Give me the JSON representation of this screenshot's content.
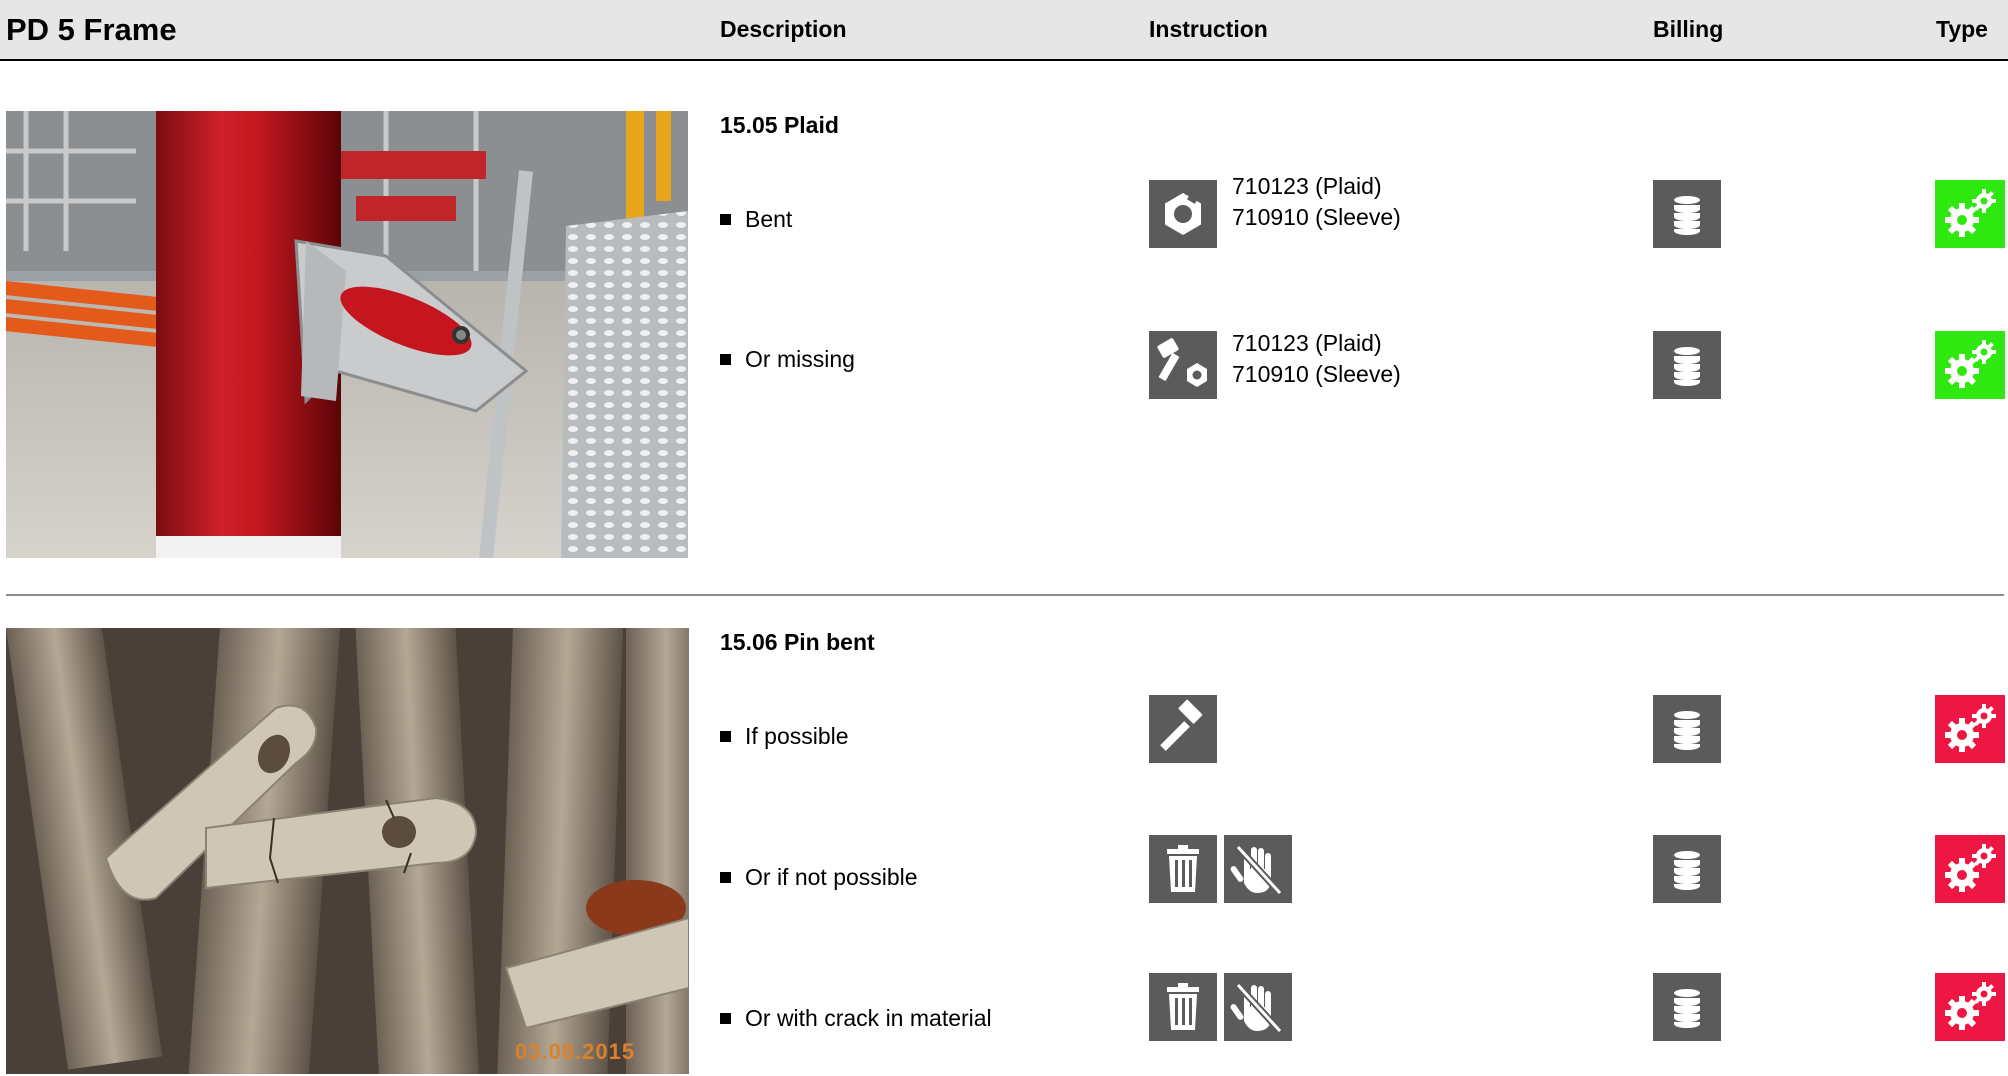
{
  "header": {
    "title": "PD 5 Frame",
    "col_description": "Description",
    "col_instruction": "Instruction",
    "col_billing": "Billing",
    "col_type": "Type"
  },
  "sections": [
    {
      "title": "15.05 Plaid",
      "items": [
        {
          "label": "Bent",
          "instruction_icons": [
            "nut-icon"
          ],
          "refs": [
            "710123 (Plaid)",
            "710910 (Sleeve)"
          ],
          "billing_icon": "coin-stack-icon",
          "type_icon": "gears-icon",
          "type_color": "#2ee80f"
        },
        {
          "label": "Or missing",
          "instruction_icons": [
            "bolt-nut-icon"
          ],
          "refs": [
            "710123 (Plaid)",
            "710910 (Sleeve)"
          ],
          "billing_icon": "coin-stack-icon",
          "type_icon": "gears-icon",
          "type_color": "#2ee80f"
        }
      ]
    },
    {
      "title": "15.06 Pin bent",
      "items": [
        {
          "label": "If possible",
          "instruction_icons": [
            "hammer-icon"
          ],
          "refs": [],
          "billing_icon": "coin-stack-icon",
          "type_icon": "gears-icon",
          "type_color": "#ee1744"
        },
        {
          "label": "Or if not possible",
          "instruction_icons": [
            "trash-icon",
            "no-hand-icon"
          ],
          "refs": [],
          "billing_icon": "coin-stack-icon",
          "type_icon": "gears-icon",
          "type_color": "#ee1744"
        },
        {
          "label": "Or with crack in material",
          "instruction_icons": [
            "trash-icon",
            "no-hand-icon"
          ],
          "refs": [],
          "billing_icon": "coin-stack-icon",
          "type_icon": "gears-icon",
          "type_color": "#ee1744"
        }
      ]
    }
  ],
  "photo_datestamp": "03.08.2015"
}
